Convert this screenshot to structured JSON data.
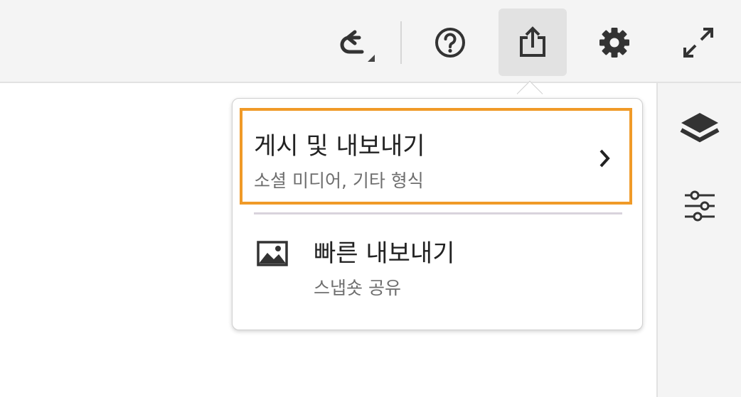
{
  "toolbar": {
    "undo_icon": "undo-icon",
    "help_icon": "help-icon",
    "share_icon": "share-export-icon",
    "settings_icon": "gear-icon",
    "fullscreen_icon": "expand-icon"
  },
  "side_panel": {
    "layers_icon": "layers-icon",
    "adjust_icon": "sliders-icon"
  },
  "popover": {
    "publish": {
      "title": "게시 및 내보내기",
      "subtitle": "소셜 미디어, 기타 형식",
      "highlight_color": "#f09a28"
    },
    "quick_export": {
      "title": "빠른 내보내기",
      "subtitle": "스냅숏 공유",
      "icon": "image-icon"
    }
  }
}
